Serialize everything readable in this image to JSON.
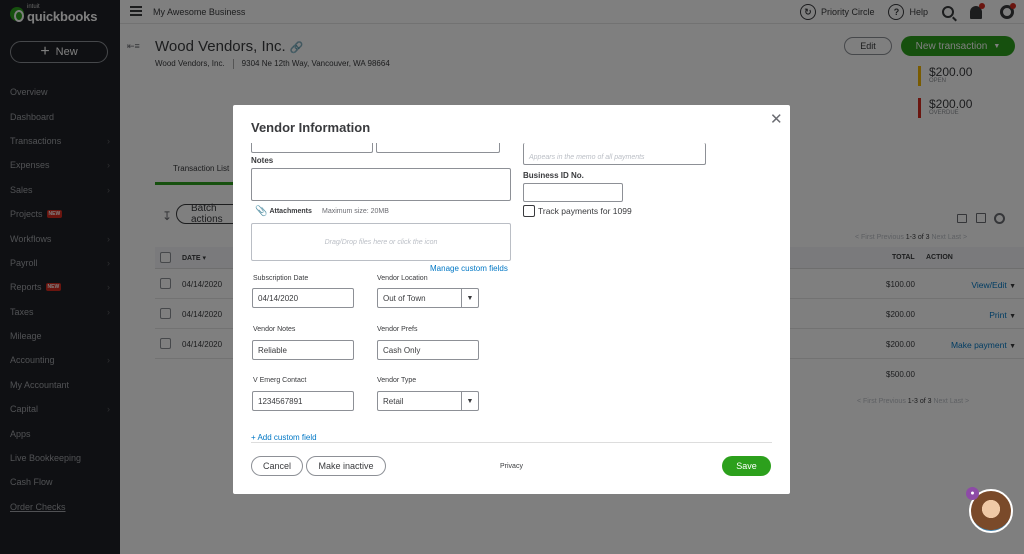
{
  "app": {
    "logo_small": "intuit",
    "logo_main": "quickbooks"
  },
  "sidebar": {
    "new_label": "New",
    "items": [
      {
        "label": "Overview",
        "chevron": false,
        "badge": ""
      },
      {
        "label": "Dashboard",
        "chevron": false,
        "badge": ""
      },
      {
        "label": "Transactions",
        "chevron": true,
        "badge": ""
      },
      {
        "label": "Expenses",
        "chevron": true,
        "badge": ""
      },
      {
        "label": "Sales",
        "chevron": true,
        "badge": ""
      },
      {
        "label": "Projects",
        "chevron": false,
        "badge": "NEW"
      },
      {
        "label": "Workflows",
        "chevron": true,
        "badge": ""
      },
      {
        "label": "Payroll",
        "chevron": true,
        "badge": ""
      },
      {
        "label": "Reports",
        "chevron": true,
        "badge": "NEW"
      },
      {
        "label": "Taxes",
        "chevron": true,
        "badge": ""
      },
      {
        "label": "Mileage",
        "chevron": false,
        "badge": ""
      },
      {
        "label": "Accounting",
        "chevron": true,
        "badge": ""
      },
      {
        "label": "My Accountant",
        "chevron": false,
        "badge": ""
      },
      {
        "label": "Capital",
        "chevron": true,
        "badge": ""
      },
      {
        "label": "Apps",
        "chevron": false,
        "badge": ""
      },
      {
        "label": "Live Bookkeeping",
        "chevron": false,
        "badge": ""
      },
      {
        "label": "Cash Flow",
        "chevron": false,
        "badge": ""
      },
      {
        "label": "Order Checks",
        "chevron": false,
        "badge": "",
        "underline": true
      }
    ]
  },
  "topbar": {
    "business_name": "My Awesome Business",
    "priority_circle": "Priority Circle",
    "help": "Help"
  },
  "vendor": {
    "name": "Wood Vendors, Inc.",
    "company": "Wood Vendors, Inc.",
    "address": "9304 Ne 12th Way, Vancouver, WA 98664",
    "edit_label": "Edit",
    "new_transaction_label": "New transaction",
    "open_amount": "$200.00",
    "open_label": "OPEN",
    "overdue_amount": "$200.00",
    "overdue_label": "OVERDUE",
    "tab_label": "Transaction List",
    "batch_label": "Batch actions"
  },
  "table": {
    "headers": {
      "date": "DATE",
      "total": "TOTAL",
      "action": "ACTION"
    },
    "pager": "1-3 of 3",
    "pager_first": "< First",
    "pager_prev": "Previous",
    "pager_next": "Next",
    "pager_last": "Last >",
    "rows": [
      {
        "date": "04/14/2020",
        "total": "$100.00",
        "action": "View/Edit"
      },
      {
        "date": "04/14/2020",
        "total": "$200.00",
        "action": "Print"
      },
      {
        "date": "04/14/2020",
        "total": "$200.00",
        "action": "Make payment"
      }
    ],
    "sum": "$500.00"
  },
  "modal": {
    "title": "Vendor Information",
    "notes_label": "Notes",
    "attachments_label": "Attachments",
    "max_size": "Maximum size: 20MB",
    "dropzone": "Drag/Drop files here or click the icon",
    "memo_placeholder": "Appears in the memo of all payments",
    "business_id_label": "Business ID No.",
    "track_1099_label": "Track payments for 1099",
    "manage_custom_fields": "Manage custom fields",
    "fields": {
      "subscription_date": {
        "label": "Subscription Date",
        "value": "04/14/2020"
      },
      "vendor_location": {
        "label": "Vendor Location",
        "value": "Out of Town"
      },
      "vendor_notes": {
        "label": "Vendor Notes",
        "value": "Reliable"
      },
      "vendor_prefs": {
        "label": "Vendor Prefs",
        "value": "Cash Only"
      },
      "v_emerg_contact": {
        "label": "V Emerg Contact",
        "value": "1234567891"
      },
      "vendor_type": {
        "label": "Vendor Type",
        "value": "Retail"
      }
    },
    "add_custom_field": "+ Add custom field",
    "cancel_label": "Cancel",
    "make_inactive_label": "Make inactive",
    "privacy_label": "Privacy",
    "save_label": "Save"
  },
  "colors": {
    "brand_green": "#2ca01c",
    "sidebar_bg": "#1f2126",
    "link_blue": "#0077c5",
    "open_bar": "#f2b600",
    "overdue_bar": "#d52b1e"
  }
}
